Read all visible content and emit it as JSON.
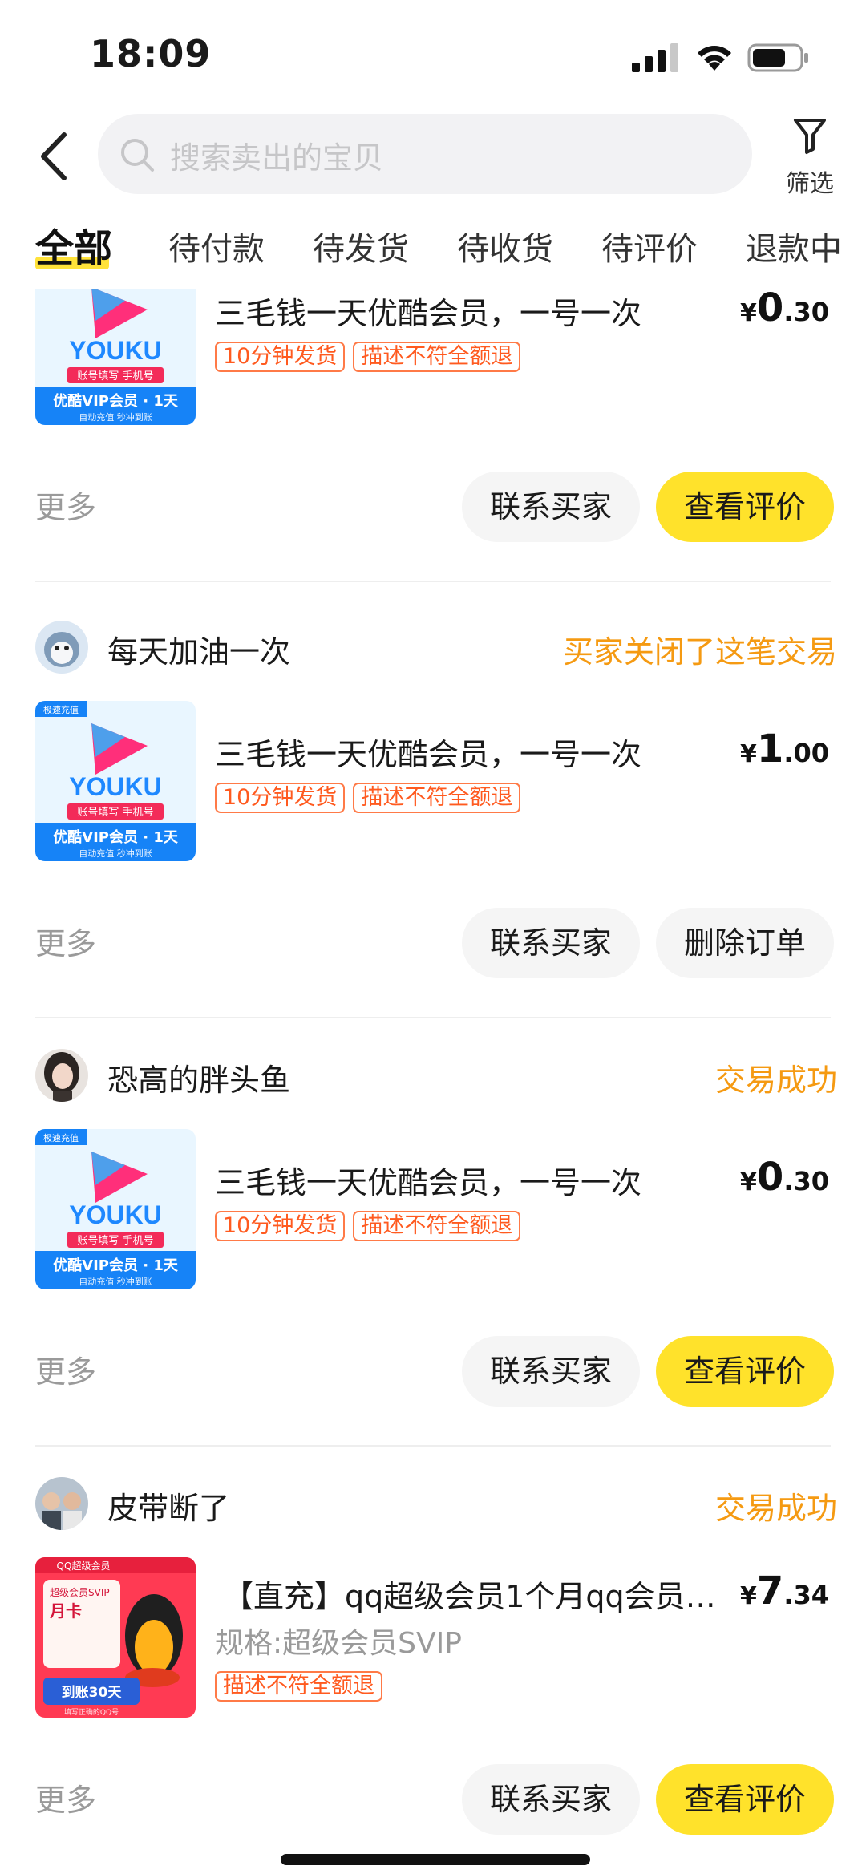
{
  "status_bar": {
    "time": "18:09",
    "icons": [
      "signal-icon",
      "wifi-icon",
      "battery-icon"
    ]
  },
  "header": {
    "search_placeholder": "搜索卖出的宝贝",
    "filter_label": "筛选"
  },
  "tabs": [
    {
      "label": "全部",
      "active": true
    },
    {
      "label": "待付款"
    },
    {
      "label": "待发货"
    },
    {
      "label": "待收货"
    },
    {
      "label": "待评价"
    },
    {
      "label": "退款中"
    }
  ],
  "orders": [
    {
      "product_title": "三毛钱一天优酷会员，一号一次",
      "tags": [
        "10分钟发货",
        "描述不符全额退"
      ],
      "price": {
        "yen": "¥",
        "int": "0",
        "dec": ".30"
      },
      "more": "更多",
      "buttons": [
        "联系买家",
        "查看评价"
      ]
    },
    {
      "seller": "每天加油一次",
      "status": "买家关闭了这笔交易",
      "product_title": "三毛钱一天优酷会员，一号一次",
      "tags": [
        "10分钟发货",
        "描述不符全额退"
      ],
      "price": {
        "yen": "¥",
        "int": "1",
        "dec": ".00"
      },
      "more": "更多",
      "buttons": [
        "联系买家",
        "删除订单"
      ]
    },
    {
      "seller": "恐高的胖头鱼",
      "status": "交易成功",
      "product_title": "三毛钱一天优酷会员，一号一次",
      "tags": [
        "10分钟发货",
        "描述不符全额退"
      ],
      "price": {
        "yen": "¥",
        "int": "0",
        "dec": ".30"
      },
      "more": "更多",
      "buttons": [
        "联系买家",
        "查看评价"
      ]
    },
    {
      "seller": "皮带断了",
      "status": "交易成功",
      "product_title": "【直充】qq超级会员1个月qq会员…",
      "spec": "规格:超级会员SVIP",
      "tags": [
        "描述不符全额退"
      ],
      "price": {
        "yen": "¥",
        "int": "7",
        "dec": ".34"
      },
      "more": "更多",
      "buttons": [
        "联系买家",
        "查看评价"
      ]
    }
  ],
  "thumbs": {
    "youku": {
      "badge": "极速充值",
      "logo": "YOUKU",
      "line1a": "账号填写",
      "line1b": "手机号",
      "line2": "优酷VIP会员 · 1天",
      "line3": "自动充值  秒冲到账"
    },
    "qq": {
      "top": "QQ超级会员",
      "line1": "超级会员SVIP",
      "line2": "月卡",
      "line3": "到账30天",
      "line4": "填写正确的QQ号"
    }
  },
  "colors": {
    "accent_yellow": "#ffe22b",
    "status_orange": "#f59a12",
    "tag_red": "#ff5a1f"
  }
}
